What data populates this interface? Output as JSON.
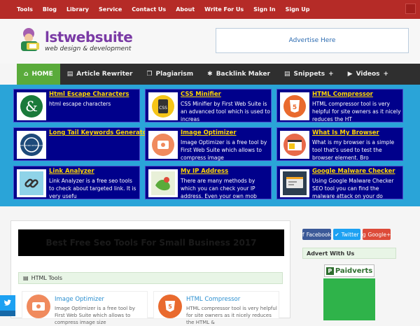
{
  "topnav": [
    "Tools",
    "Blog",
    "Library",
    "Service",
    "Contact Us",
    "About",
    "Write For Us",
    "Sign In",
    "Sign Up"
  ],
  "logo": {
    "brand": "lstwebsuite",
    "tagline": "web design & development"
  },
  "advert": "Advertise Here",
  "mainnav": [
    {
      "label": "HOME",
      "icon": "home-icon",
      "glyph": "⌂"
    },
    {
      "label": "Article Rewriter",
      "icon": "document-icon",
      "glyph": "▤"
    },
    {
      "label": "Plagiarism",
      "icon": "copy-icon",
      "glyph": "❐"
    },
    {
      "label": "Backlink Maker",
      "icon": "link-icon",
      "glyph": "✱"
    },
    {
      "label": "Snippets",
      "icon": "code-icon",
      "glyph": "▤",
      "plus": "+"
    },
    {
      "label": "Videos",
      "icon": "video-icon",
      "glyph": "▶",
      "plus": "+"
    }
  ],
  "tools": [
    {
      "title": "Html Escape Characters",
      "desc": "html escape characters"
    },
    {
      "title": "CSS Minifier",
      "desc": "CSS Minifier by First Web Suite is an advanced tool which is used to increas"
    },
    {
      "title": "HTML Compressor",
      "desc": "HTML compressor tool is very helpful for site owners as it nicely reduces the HT"
    },
    {
      "title": "Long Tail Keywords Generator",
      "desc": ""
    },
    {
      "title": "Image Optimizer",
      "desc": "Image Optimizer is a free tool by First Web Suite which allows to compress image"
    },
    {
      "title": "What Is My Browser",
      "desc": "What is my browser is a simple tool that's used to test the browser element. Bro"
    },
    {
      "title": "Link Analyzer",
      "desc": "Link Analyzer is a free seo tools to check about targeted link. It is very usefu"
    },
    {
      "title": "My IP Address",
      "desc": "There are many methods by which you can check your IP address. Even your own mob"
    },
    {
      "title": "Google Malware Checker",
      "desc": "Using Google Malware Checker SEO tool you can find the malware attack on your do"
    }
  ],
  "thumbs": {
    "t1": "&",
    "t2": "CSS",
    "t3": "5",
    "t4": "KEYWORD RESEARCH",
    "t6": "",
    "t9": ""
  },
  "banner": "Best Free Seo Tools For Small Business 2017",
  "section_title": "HTML Tools",
  "entries": [
    {
      "title": "Image Optimizer",
      "desc": "Image Optimizer is a free tool by First Web Suite which allows to compress image size"
    },
    {
      "title": "HTML Compressor",
      "desc": "HTML compressor tool is very helpful for site owners as it nicely reduces the HTML &"
    }
  ],
  "social": [
    {
      "label": "Facebook",
      "color": "#3b5998",
      "glyph": "f"
    },
    {
      "label": "Twitter",
      "color": "#1da1f2",
      "glyph": "✔"
    },
    {
      "label": "Google+",
      "color": "#dd4b39",
      "glyph": "g"
    }
  ],
  "sidebar": {
    "advert_title": "Advert With Us",
    "paid": "Paidverts",
    "paid_mark": "P"
  }
}
